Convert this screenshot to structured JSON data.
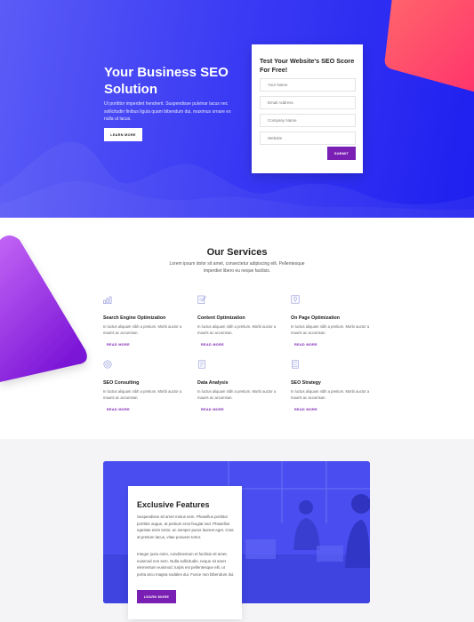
{
  "hero": {
    "title": "Your Business SEO Solution",
    "text": "Ut porttitor imperdiet hendrerit. Suspendisse pulvinar lacus nec sollicitudin finibus ligula quam bibendum dui, maximus ornare ex nulla ut lacus.",
    "button_label": "LEARN MORE"
  },
  "form": {
    "title": "Test Your Website's SEO Score For Free!",
    "name_placeholder": "Your Name",
    "email_placeholder": "Email Address",
    "company_placeholder": "Company Name",
    "website_placeholder": "Website",
    "submit_label": "SUBMIT"
  },
  "services": {
    "title": "Our Services",
    "subtitle": "Lorem ipsum dolor sit amet, consectetur adipiscing elit. Pellentesque imperdiet libero eu neque facilisis.",
    "items": [
      {
        "name": "Search Engine Optimization",
        "desc": "In luctus aliquam nibh a pretium. Morbi auctor a mauris ac accumsan.",
        "more": "READ MORE",
        "icon": "bar-chart-icon"
      },
      {
        "name": "Content Optimization",
        "desc": "In luctus aliquam nibh a pretium. Morbi auctor a mauris ac accumsan.",
        "more": "READ MORE",
        "icon": "edit-document-icon"
      },
      {
        "name": "On Page Optimization",
        "desc": "In luctus aliquam nibh a pretium. Morbi auctor a mauris ac accumsan.",
        "more": "READ MORE",
        "icon": "map-pin-icon"
      },
      {
        "name": "SEO Consulting",
        "desc": "In luctus aliquam nibh a pretium. Morbi auctor a mauris ac accumsan.",
        "more": "READ MORE",
        "icon": "target-icon"
      },
      {
        "name": "Data Analysis",
        "desc": "In luctus aliquam nibh a pretium. Morbi auctor a mauris ac accumsan.",
        "more": "READ MORE",
        "icon": "report-icon"
      },
      {
        "name": "SEO Strategy",
        "desc": "In luctus aliquam nibh a pretium. Morbi auctor a mauris ac accumsan.",
        "more": "READ MORE",
        "icon": "checklist-icon"
      }
    ]
  },
  "features": {
    "title": "Exclusive Features",
    "p1": "Suspendisse sit amet metus sem. Phasellus porttitor porttitor augue, at pretium eros feugiat sed. Phasellus egestas enim tortor, ac semper purus laoreet eget. Cras at pretium lacus, vitae posuere tortor.",
    "p2": "Integer justo enim, condimentum et facilisis sit amet, euismod non sem. Nulla sollicitudin, neque sit amet elementum euismod, turpis est pellentesque elit, ut porta arcu magna sodales dui. Fusce non bibendum dui.",
    "button_label": "LEARN MORE"
  },
  "colors": {
    "hero_start": "#5b5cf6",
    "hero_end": "#1f1ff0",
    "accent_purple": "#7a1fb3",
    "pink": "#ff3d6e"
  }
}
